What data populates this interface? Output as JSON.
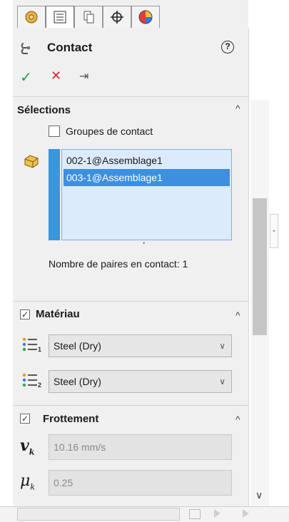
{
  "tabs": [
    {
      "icon": "feature-manager-icon"
    },
    {
      "icon": "property-manager-icon",
      "active": true
    },
    {
      "icon": "configuration-manager-icon"
    },
    {
      "icon": "dim-xpert-icon"
    },
    {
      "icon": "display-manager-icon"
    }
  ],
  "header": {
    "title": "Contact",
    "help_glyph": "?",
    "ok_glyph": "✓",
    "cancel_glyph": "✕",
    "pin_glyph": "⇥"
  },
  "selections": {
    "title": "Sélections",
    "contact_groups_label": "Groupes de contact",
    "contact_groups_checked": false,
    "items": [
      "002-1@Assemblage1",
      "003-1@Assemblage1"
    ],
    "selected_index": 1,
    "pairs_text": "Nombre de paires en contact: 1"
  },
  "material": {
    "title": "Matériau",
    "checked": true,
    "material1": "Steel (Dry)",
    "material2": "Steel (Dry)"
  },
  "friction": {
    "title": "Frottement",
    "checked": true,
    "velocity_symbol": "v",
    "velocity_sub": "k",
    "velocity_value": "10.16 mm/s",
    "coef_symbol": "μ",
    "coef_sub": "k",
    "coef_value": "0.25"
  },
  "glyphs": {
    "collapse": "^",
    "dropdown": "∨",
    "scroll_down": "∨",
    "list_resize": "•",
    "side_handle": "•"
  },
  "colors": {
    "accept": "#1e9e3a",
    "cancel": "#e02222",
    "selection_blue": "#3d8fe0",
    "list_bg": "#dcebfb"
  }
}
